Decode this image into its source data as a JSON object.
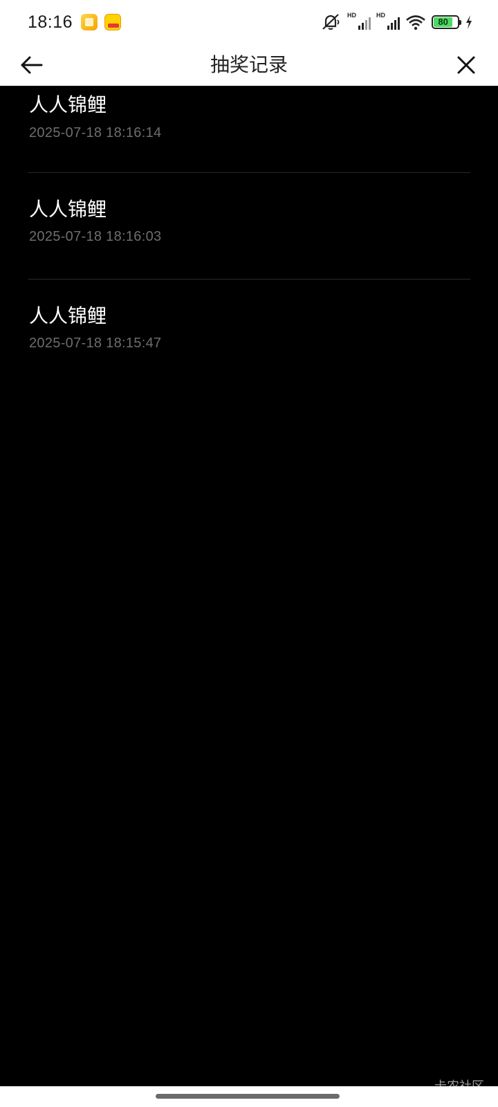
{
  "status_bar": {
    "time": "18:16",
    "battery": "80",
    "icons": [
      "note-app-icon",
      "game-app-icon",
      "mute-icon",
      "hd-signal-icon",
      "hd-signal-icon",
      "wifi-icon",
      "battery-icon",
      "charging-icon"
    ]
  },
  "header": {
    "title": "抽奖记录",
    "back_icon": "arrow-left-icon",
    "close_icon": "close-icon"
  },
  "records": [
    {
      "name": "人人锦鲤",
      "time": "2025-07-18 18:16:14"
    },
    {
      "name": "人人锦鲤",
      "time": "2025-07-18 18:16:03"
    },
    {
      "name": "人人锦鲤",
      "time": "2025-07-18 18:15:47"
    }
  ],
  "watermark": "卡农社区",
  "colors": {
    "background": "#000000",
    "header_bg": "#ffffff",
    "title_text": "#222222",
    "record_name": "#ffffff",
    "record_time": "#6e6e6e",
    "divider": "#2a2a2a"
  }
}
